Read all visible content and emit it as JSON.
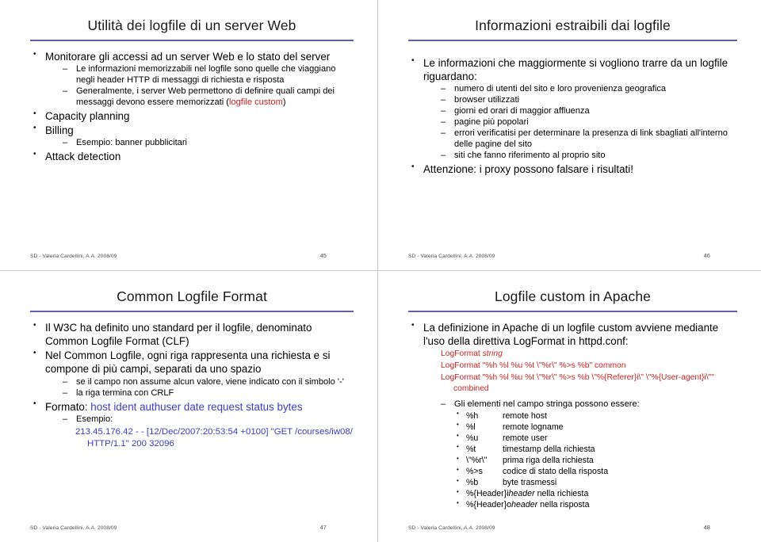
{
  "deck": {
    "footer_author": "SD - Valeria Cardellini, A.A. 2008/09"
  },
  "slides": [
    {
      "title": "Utilità dei logfile di un server Web",
      "page": "45",
      "bullets": {
        "b1": "Monitorare gli accessi ad un server Web e lo stato del server",
        "s1": "Le informazioni memorizzabili nel logfile sono quelle che viaggiano negli header HTTP di messaggi di richiesta e risposta",
        "s2_pre": "Generalmente, i server Web permettono di definire quali campi dei messaggi devono essere memorizzati (",
        "s2_red": "logfile custom",
        "s2_post": ")",
        "b2": "Capacity planning",
        "b3": "Billing",
        "s3": "Esempio: banner pubblicitari",
        "b4": "Attack detection"
      }
    },
    {
      "title": "Informazioni estraibili dai logfile",
      "page": "46",
      "bullets": {
        "b1": "Le informazioni che maggiormente si vogliono trarre da un logfile riguardano:",
        "s1": "numero di utenti del sito e loro provenienza geografica",
        "s2": "browser utilizzati",
        "s3": "giorni ed orari di maggior affluenza",
        "s4": "pagine più popolari",
        "s5": "errori verificatisi per determinare la presenza di link sbagliati all'interno delle pagine del sito",
        "s6": "siti che fanno riferimento al proprio sito",
        "b2": "Attenzione: i proxy possono falsare i risultati!"
      }
    },
    {
      "title": "Common Logfile Format",
      "page": "47",
      "bullets": {
        "b1": "Il W3C ha definito uno standard per il logfile, denominato Common Logfile Format (CLF)",
        "b2": "Nel Common Logfile, ogni riga rappresenta una richiesta e si compone di più campi, separati da uno spazio",
        "s1": "se il campo non assume alcun valore, viene indicato con il simbolo '-'",
        "s2": "la riga termina con CRLF",
        "b3_pre": "Formato: ",
        "b3_blue": "host ident authuser date request status bytes",
        "s3": "Esempio:",
        "example_line1": "213.45.176.42 - - [12/Dec/2007:20:53:54 +0100] \"GET /courses/iw08/",
        "example_line2": "HTTP/1.1\" 200 32096"
      }
    },
    {
      "title": "Logfile custom in Apache",
      "page": "48",
      "bullets": {
        "b1": "La definizione in Apache di un logfile custom avviene mediante l'uso della direttiva LogFormat in httpd.conf:",
        "code_line1_cmd": "LogFormat ",
        "code_line1_arg": "string",
        "code_line2": "LogFormat \"%h %l %u %t \\\"%r\\\" %>s %b\" common",
        "code_line3": "LogFormat \"%h %l %u %t \\\"%r\\\" %>s %b \\\"%{Referer}i\\\" \\\"%{User-agent}i\\\"\"",
        "code_line3b": "combined",
        "s1": "Gli elementi nel campo stringa possono essere:",
        "directives": [
          {
            "key": "%h",
            "desc": "remote host",
            "ital": ""
          },
          {
            "key": "%l",
            "desc": "remote logname",
            "ital": ""
          },
          {
            "key": "%u",
            "desc": "remote user",
            "ital": ""
          },
          {
            "key": "%t",
            "desc": "timestamp della richiesta",
            "ital": ""
          },
          {
            "key": "\\\"%r\\\"",
            "desc": "prima riga della richiesta",
            "ital": ""
          },
          {
            "key": "%>s",
            "desc": "codice di stato della risposta",
            "ital": ""
          },
          {
            "key": "%b",
            "desc": "byte trasmessi",
            "ital": ""
          },
          {
            "key": "%{Header}i",
            "desc": "nella richiesta",
            "ital": "header"
          },
          {
            "key": "%{Header}o",
            "desc": "nella risposta",
            "ital": "header"
          }
        ]
      }
    }
  ],
  "colors": {
    "title_rule": "#5f5fa8",
    "accent_red": "#cc2222",
    "accent_blue": "#3b3bc4",
    "footer_text": "#4a4a4a"
  }
}
